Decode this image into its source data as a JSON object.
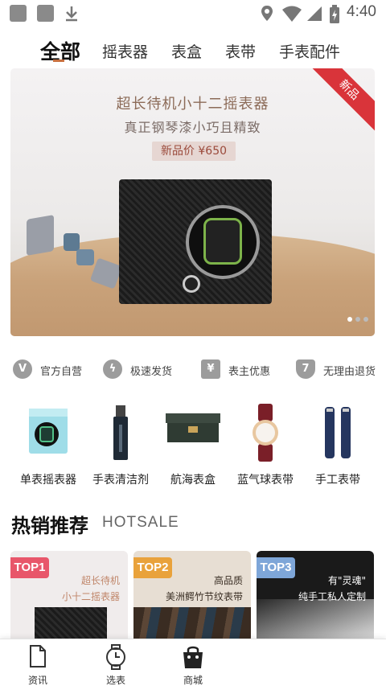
{
  "status_bar": {
    "time": "4:40",
    "icons": [
      "app-icon",
      "app-icon",
      "download-icon",
      "location-icon",
      "wifi-icon",
      "cellular-icon",
      "battery-charging-icon"
    ]
  },
  "tabs": [
    {
      "label": "全部",
      "active": true
    },
    {
      "label": "摇表器",
      "active": false
    },
    {
      "label": "表盒",
      "active": false
    },
    {
      "label": "表带",
      "active": false
    },
    {
      "label": "手表配件",
      "active": false
    }
  ],
  "banner": {
    "title": "超长待机小十二摇表器",
    "subtitle": "真正钢琴漆小巧且精致",
    "price": "新品价 ¥650",
    "ribbon": "新品",
    "current_slide": 1,
    "slide_count": 3
  },
  "features": [
    {
      "label": "官方自营",
      "icon": "v-badge-icon",
      "glyph": "V"
    },
    {
      "label": "极速发货",
      "icon": "lightning-icon",
      "glyph": "ϟ"
    },
    {
      "label": "表主优惠",
      "icon": "yen-coupon-icon",
      "glyph": "¥"
    },
    {
      "label": "无理由退货",
      "icon": "seven-shield-icon",
      "glyph": "7"
    }
  ],
  "categories": [
    {
      "label": "单表摇表器",
      "icon": "watch-winder-icon"
    },
    {
      "label": "手表清洁剂",
      "icon": "cleaner-bottle-icon"
    },
    {
      "label": "航海表盒",
      "icon": "watch-box-icon"
    },
    {
      "label": "蓝气球表带",
      "icon": "watch-strap-icon"
    },
    {
      "label": "手工表带",
      "icon": "leather-strap-icon"
    }
  ],
  "hot_sale": {
    "title": "热销推荐",
    "subtitle": "HOTSALE",
    "items": [
      {
        "badge": "TOP1",
        "line1": "超长待机",
        "line2": "小十二摇表器",
        "badge_color": "#e8566a",
        "text_color": "#c0866a",
        "bg": "#f0ecec"
      },
      {
        "badge": "TOP2",
        "line1": "高品质",
        "line2": "美洲鳄竹节纹表带",
        "badge_color": "#e9a23b",
        "text_color": "#3a2e24",
        "bg": "#e7ded3"
      },
      {
        "badge": "TOP3",
        "line1": "有\"灵魂\"",
        "line2": "纯手工私人定制",
        "badge_color": "#7ea6d8",
        "text_color": "#ffffff",
        "bg": "#1a1a1a"
      }
    ]
  },
  "bottom_nav": [
    {
      "label": "资讯",
      "icon": "document-icon",
      "active": false
    },
    {
      "label": "选表",
      "icon": "watch-icon",
      "active": false
    },
    {
      "label": "商城",
      "icon": "shopping-bag-icon",
      "active": true
    }
  ],
  "colors": {
    "accent": "#c8703f",
    "ribbon": "#d9343a"
  }
}
